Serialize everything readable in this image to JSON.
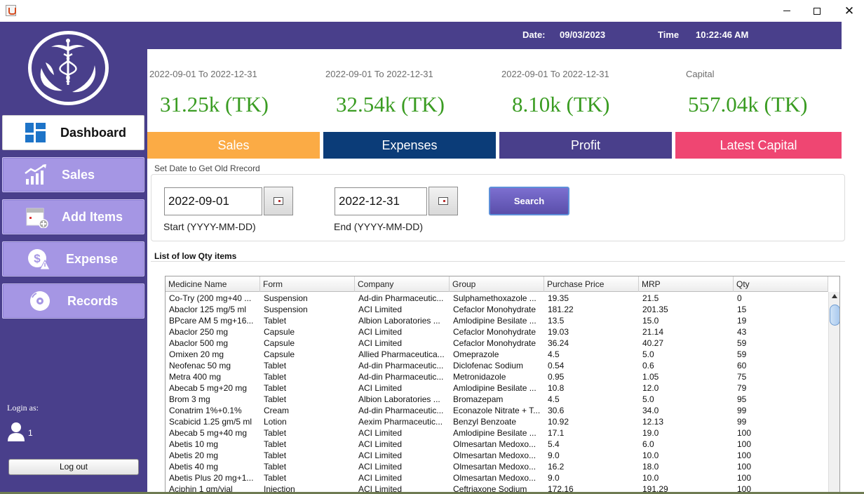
{
  "window": {
    "minimize": "",
    "maximize": "",
    "close": "✕"
  },
  "topbar": {
    "date_label": "Date:",
    "date_value": "09/03/2023",
    "time_label": "Time",
    "time_value": "10:22:46 AM"
  },
  "sidebar": {
    "items": [
      {
        "label": "Dashboard",
        "icon": "dashboard-icon"
      },
      {
        "label": "Sales",
        "icon": "sales-chart-icon"
      },
      {
        "label": "Add Items",
        "icon": "add-items-icon"
      },
      {
        "label": "Expense",
        "icon": "expense-dollar-icon"
      },
      {
        "label": "Records",
        "icon": "records-disc-icon"
      }
    ],
    "login_as": "Login as:",
    "user_id": "1",
    "logout": "Log out"
  },
  "cards": [
    {
      "range": "2022-09-01 To 2022-12-31",
      "amount": "31.25k  (TK)",
      "label": "Sales",
      "color": "#fbab45"
    },
    {
      "range": "2022-09-01 To 2022-12-31",
      "amount": "32.54k  (TK)",
      "label": "Expenses",
      "color": "#0b3c78"
    },
    {
      "range": "2022-09-01 To 2022-12-31",
      "amount": "8.10k  (TK)",
      "label": "Profit",
      "color": "#493f8b"
    },
    {
      "range": "Capital",
      "amount": "557.04k  (TK)",
      "label": "Latest Capital",
      "color": "#ef4672"
    }
  ],
  "search_panel": {
    "title": "Set Date to Get Old Rrecord",
    "start_value": "2022-09-01",
    "start_caption": "Start (YYYY-MM-DD)",
    "end_value": "2022-12-31",
    "end_caption": "End (YYYY-MM-DD)",
    "search_label": "Search"
  },
  "low_qty": {
    "title": "List of low Qty items",
    "columns": [
      "Medicine Name",
      "Form",
      "Company",
      "Group",
      "Purchase Price",
      "MRP",
      "Qty"
    ],
    "rows": [
      [
        "Co-Try (200 mg+40 ...",
        "Suspension",
        "Ad-din Pharmaceutic...",
        "Sulphamethoxazole ...",
        "19.35",
        "21.5",
        "0"
      ],
      [
        "Abaclor 125 mg/5 ml",
        "Suspension",
        "ACI Limited",
        "Cefaclor Monohydrate",
        "181.22",
        "201.35",
        "15"
      ],
      [
        "BPcare AM 5 mg+16...",
        "Tablet",
        "Albion Laboratories ...",
        "Amlodipine Besilate ...",
        "13.5",
        "15.0",
        "19"
      ],
      [
        "Abaclor 250 mg",
        "Capsule",
        "ACI Limited",
        "Cefaclor Monohydrate",
        "19.03",
        "21.14",
        "43"
      ],
      [
        "Abaclor 500 mg",
        "Capsule",
        "ACI Limited",
        "Cefaclor Monohydrate",
        "36.24",
        "40.27",
        "59"
      ],
      [
        "Omixen 20 mg",
        "Capsule",
        "Allied Pharmaceutica...",
        "Omeprazole",
        "4.5",
        "5.0",
        "59"
      ],
      [
        "Neofenac 50 mg",
        "Tablet",
        "Ad-din Pharmaceutic...",
        "Diclofenac Sodium",
        "0.54",
        "0.6",
        "60"
      ],
      [
        "Metra 400 mg",
        "Tablet",
        "Ad-din Pharmaceutic...",
        "Metronidazole",
        "0.95",
        "1.05",
        "75"
      ],
      [
        "Abecab 5 mg+20 mg",
        "Tablet",
        "ACI Limited",
        "Amlodipine Besilate ...",
        "10.8",
        "12.0",
        "79"
      ],
      [
        "Brom 3 mg",
        "Tablet",
        "Albion Laboratories ...",
        "Bromazepam",
        "4.5",
        "5.0",
        "95"
      ],
      [
        "Conatrim 1%+0.1%",
        "Cream",
        "Ad-din Pharmaceutic...",
        "Econazole Nitrate + T...",
        "30.6",
        "34.0",
        "99"
      ],
      [
        "Scabicid 1.25 gm/5 ml",
        "Lotion",
        "Aexim Pharmaceutic...",
        "Benzyl Benzoate",
        "10.92",
        "12.13",
        "99"
      ],
      [
        "Abecab 5 mg+40 mg",
        "Tablet",
        "ACI Limited",
        "Amlodipine Besilate ...",
        "17.1",
        "19.0",
        "100"
      ],
      [
        "Abetis 10 mg",
        "Tablet",
        "ACI Limited",
        "Olmesartan Medoxo...",
        "5.4",
        "6.0",
        "100"
      ],
      [
        "Abetis 20 mg",
        "Tablet",
        "ACI Limited",
        "Olmesartan Medoxo...",
        "9.0",
        "10.0",
        "100"
      ],
      [
        "Abetis 40 mg",
        "Tablet",
        "ACI Limited",
        "Olmesartan Medoxo...",
        "16.2",
        "18.0",
        "100"
      ],
      [
        "Abetis Plus 20 mg+1...",
        "Tablet",
        "ACI Limited",
        "Olmesartan Medoxo...",
        "9.0",
        "10.0",
        "100"
      ],
      [
        "Aciphin 1 gm/vial",
        "Injection",
        "ACI Limited",
        "Ceftriaxone Sodium",
        "172.16",
        "191.29",
        "100"
      ]
    ]
  }
}
